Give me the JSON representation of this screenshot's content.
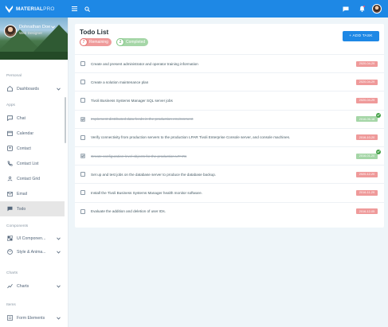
{
  "brand": {
    "name_bold": "MATERIAL",
    "name_thin": "PRO"
  },
  "colors": {
    "primary": "#1e88e5",
    "danger_light": "#ef9a9a",
    "success_light": "#a5d6a7"
  },
  "profile": {
    "name": "Dohnathan Doe",
    "role": "Web Designer"
  },
  "sidebar": {
    "sections": {
      "personal": "Personal",
      "apps": "Apps",
      "components": "Components",
      "charts": "Charts",
      "items": "Items"
    },
    "dashboards": "Dashboards",
    "apps_items": [
      {
        "label": "Chat",
        "icon": "chat-icon"
      },
      {
        "label": "Calendar",
        "icon": "calendar-icon"
      },
      {
        "label": "Contact",
        "icon": "contact-icon"
      },
      {
        "label": "Contact List",
        "icon": "phone-icon"
      },
      {
        "label": "Contact Grid",
        "icon": "grid-icon"
      },
      {
        "label": "Email",
        "icon": "email-icon"
      },
      {
        "label": "Todo",
        "icon": "todo-icon"
      }
    ],
    "ui_components": "UI Componen...",
    "style_animation": "Style & Anima...",
    "charts": "Charts",
    "form_elements": "Form Elements"
  },
  "todo": {
    "title": "Todo List",
    "remaining_count": "7",
    "remaining_label": "Remaining",
    "completed_count": "2",
    "completed_label": "Completed",
    "add_button": "+ ADD TASK",
    "tasks": [
      {
        "text": "Create and present administrator and operator training information",
        "date": "2020-04-29",
        "status": "open"
      },
      {
        "text": "Create a solution maintenance plan",
        "date": "2020-04-29",
        "status": "open"
      },
      {
        "text": "Tivoli Business Systems Manager SQL server jobs",
        "date": "2020-04-29",
        "status": "open"
      },
      {
        "text": "Implement distributed data feeds in the production environment",
        "date": "2016-06-18",
        "status": "done"
      },
      {
        "text": "Verify connectivity from production servers to the production LPAR Tivoli Enterprise Console server, and console machines.",
        "date": "2016-10-20",
        "status": "open"
      },
      {
        "text": "Create configuration level objects for the production LPARs",
        "date": "2016-01-20",
        "status": "done"
      },
      {
        "text": "Set up and test jobs on the database server to produce the database backup.",
        "date": "2020-12-20",
        "status": "open"
      },
      {
        "text": "Install the Tivoli Business Systems Manager health monitor software.",
        "date": "2016-11-29",
        "status": "open"
      },
      {
        "text": "Evaluate the addition and deletion of user IDs.",
        "date": "2016-12-05",
        "status": "open"
      }
    ]
  }
}
